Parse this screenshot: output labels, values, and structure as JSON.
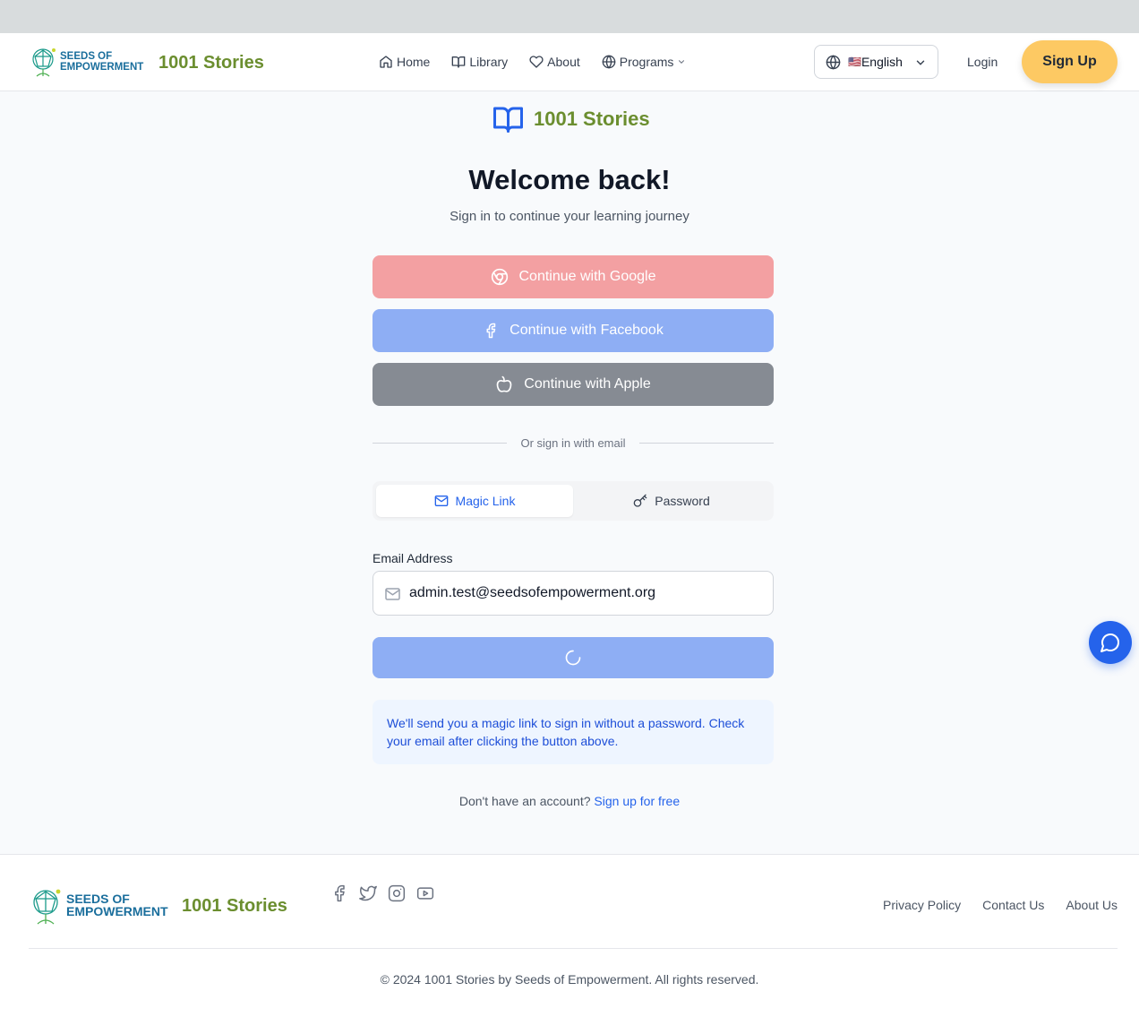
{
  "nav": {
    "logo_text": "SEEDS OF EMPOWERMENT",
    "brand": "1001 Stories",
    "links": [
      {
        "label": "Home",
        "icon": "home-icon"
      },
      {
        "label": "Library",
        "icon": "book-icon"
      },
      {
        "label": "About",
        "icon": "heart-icon"
      },
      {
        "label": "Programs",
        "icon": "globe-icon"
      }
    ],
    "language": "English",
    "language_flag": "🇺🇸",
    "login": "Login",
    "signup": "Sign Up"
  },
  "auth": {
    "brand": "1001 Stories",
    "title": "Welcome back!",
    "subtitle": "Sign in to continue your learning journey",
    "google": "Continue with Google",
    "facebook": "Continue with Facebook",
    "apple": "Continue with Apple",
    "divider": "Or sign in with email",
    "tabs": {
      "magic": "Magic Link",
      "password": "Password"
    },
    "email_label": "Email Address",
    "email_value": "admin.test@seedsofempowerment.org",
    "info": "We'll send you a magic link to sign in without a password. Check your email after clicking the button above.",
    "no_account": "Don't have an account?",
    "signup_link": "Sign up for free"
  },
  "footer": {
    "logo_text": "SEEDS OF EMPOWERMENT",
    "brand": "1001 Stories",
    "social": [
      "facebook-icon",
      "twitter-icon",
      "instagram-icon",
      "youtube-icon"
    ],
    "links": [
      "Privacy Policy",
      "Contact Us",
      "About Us"
    ],
    "copyright": "© 2024 1001 Stories by Seeds of Empowerment. All rights reserved."
  },
  "colors": {
    "brand_green": "#6b8e2f",
    "primary_blue": "#2563eb",
    "signup_yellow": "#fdc963"
  }
}
